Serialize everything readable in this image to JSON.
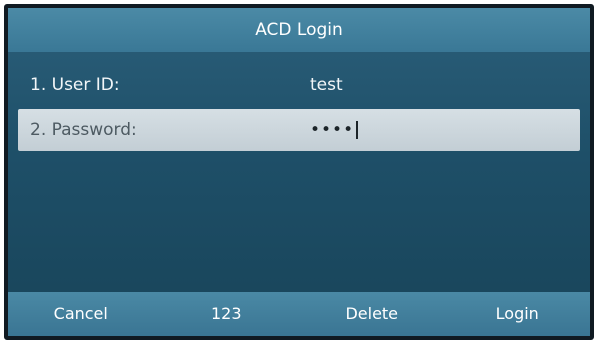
{
  "title": "ACD Login",
  "fields": [
    {
      "label": "1. User ID:",
      "value": "test"
    },
    {
      "label": "2. Password:",
      "value": "••••"
    }
  ],
  "softkeys": [
    {
      "label": "Cancel"
    },
    {
      "label": "123"
    },
    {
      "label": "Delete"
    },
    {
      "label": "Login"
    }
  ],
  "colors": {
    "title_bar": "#3f7f9c",
    "background": "#1e4f68",
    "selected_row": "#cdd6dc",
    "softkey_bar": "#3f7f9c"
  }
}
